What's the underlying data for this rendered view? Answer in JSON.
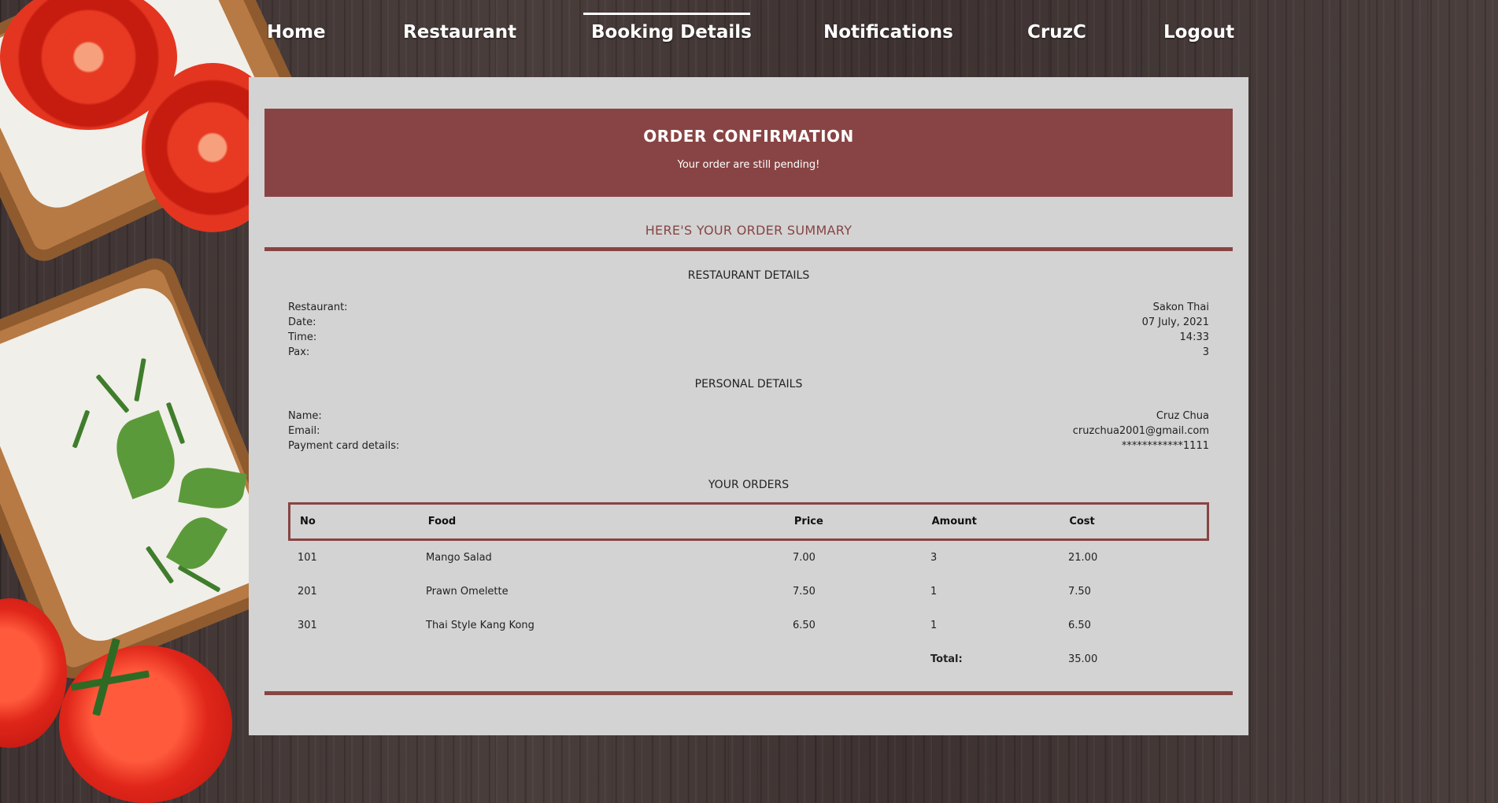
{
  "nav": {
    "home": "Home",
    "restaurant": "Restaurant",
    "booking_details": "Booking Details",
    "notifications": "Notifications",
    "user": "CruzC",
    "logout": "Logout",
    "active": "Booking Details"
  },
  "banner": {
    "title": "ORDER CONFIRMATION",
    "subtitle": "Your order are still pending!"
  },
  "summary_title": "HERE'S YOUR ORDER SUMMARY",
  "restaurant_details": {
    "heading": "RESTAURANT DETAILS",
    "rows": [
      {
        "label": "Restaurant:",
        "value": "Sakon Thai"
      },
      {
        "label": "Date:",
        "value": "07 July, 2021"
      },
      {
        "label": "Time:",
        "value": "14:33"
      },
      {
        "label": "Pax:",
        "value": "3"
      }
    ]
  },
  "personal_details": {
    "heading": "PERSONAL DETAILS",
    "rows": [
      {
        "label": "Name:",
        "value": "Cruz Chua"
      },
      {
        "label": "Email:",
        "value": "cruzchua2001@gmail.com"
      },
      {
        "label": "Payment card details:",
        "value": "************1111"
      }
    ]
  },
  "orders": {
    "heading": "YOUR ORDERS",
    "columns": [
      "No",
      "Food",
      "Price",
      "Amount",
      "Cost"
    ],
    "rows": [
      [
        "101",
        "Mango Salad",
        "7.00",
        "3",
        "21.00"
      ],
      [
        "201",
        "Prawn Omelette",
        "7.50",
        "1",
        "7.50"
      ],
      [
        "301",
        "Thai Style Kang Kong",
        "6.50",
        "1",
        "6.50"
      ]
    ],
    "total_label": "Total:",
    "total_value": "35.00"
  },
  "colors": {
    "accent": "#884444",
    "card_bg": "#d3d3d3",
    "nav_text": "#ffffff"
  }
}
